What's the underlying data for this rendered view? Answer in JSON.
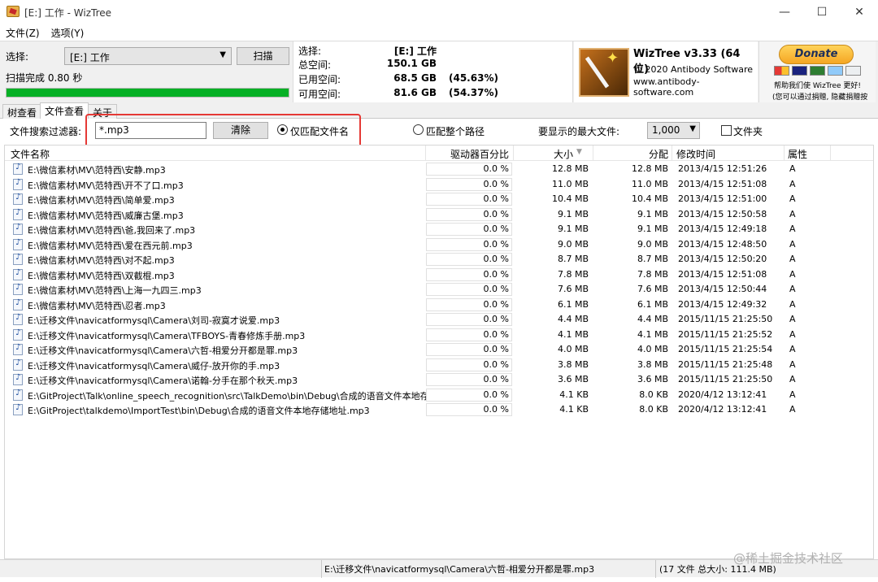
{
  "window": {
    "title": "[E:] 工作 - WizTree"
  },
  "menu": [
    "文件(Z)",
    "选项(Y)"
  ],
  "scan": {
    "select_label": "选择:",
    "drive_value": "[E:] 工作",
    "scan_button": "扫描",
    "status": "扫描完成 0.80 秒",
    "progress": 1.0
  },
  "stats": {
    "select_label": "选择:",
    "select_value": "[E:]  工作",
    "total_label": "总空间:",
    "total_value": "150.1 GB",
    "used_label": "已用空间:",
    "used_value": "68.5 GB",
    "used_pct": "(45.63%)",
    "free_label": "可用空间:",
    "free_value": "81.6 GB",
    "free_pct": "(54.37%)"
  },
  "brand": {
    "name": "WizTree v3.33 (64 位)",
    "copyright": "© 2020 Antibody Software",
    "url": "www.antibody-software.com"
  },
  "donate": {
    "button": "Donate",
    "note1": "帮助我们使 WizTree 更好!",
    "note2": "(您可以通过捐赠, 隐藏捐赠按钮)"
  },
  "tabs": [
    "树查看",
    "文件查看",
    "关于"
  ],
  "filter": {
    "label": "文件搜索过滤器:",
    "value": "*.mp3",
    "clear_button": "清除",
    "radio_filename": "仅匹配文件名",
    "radio_fullpath": "匹配整个路径",
    "max_files_label": "要显示的最大文件:",
    "max_files_value": "1,000",
    "folders_label": "文件夹"
  },
  "columns": {
    "name": "文件名称",
    "pct": "驱动器百分比",
    "size": "大小",
    "alloc": "分配",
    "mtime": "修改时间",
    "attr": "属性"
  },
  "files": [
    {
      "name": "E:\\微信素材\\MV\\范特西\\安静.mp3",
      "pct": "0.0 %",
      "size": "12.8 MB",
      "alloc": "12.8 MB",
      "mtime": "2013/4/15 12:51:26",
      "attr": "A"
    },
    {
      "name": "E:\\微信素材\\MV\\范特西\\开不了口.mp3",
      "pct": "0.0 %",
      "size": "11.0 MB",
      "alloc": "11.0 MB",
      "mtime": "2013/4/15 12:51:08",
      "attr": "A"
    },
    {
      "name": "E:\\微信素材\\MV\\范特西\\简单爱.mp3",
      "pct": "0.0 %",
      "size": "10.4 MB",
      "alloc": "10.4 MB",
      "mtime": "2013/4/15 12:51:00",
      "attr": "A"
    },
    {
      "name": "E:\\微信素材\\MV\\范特西\\威廉古堡.mp3",
      "pct": "0.0 %",
      "size": "9.1 MB",
      "alloc": "9.1 MB",
      "mtime": "2013/4/15 12:50:58",
      "attr": "A"
    },
    {
      "name": "E:\\微信素材\\MV\\范特西\\爸,我回来了.mp3",
      "pct": "0.0 %",
      "size": "9.1 MB",
      "alloc": "9.1 MB",
      "mtime": "2013/4/15 12:49:18",
      "attr": "A"
    },
    {
      "name": "E:\\微信素材\\MV\\范特西\\爱在西元前.mp3",
      "pct": "0.0 %",
      "size": "9.0 MB",
      "alloc": "9.0 MB",
      "mtime": "2013/4/15 12:48:50",
      "attr": "A"
    },
    {
      "name": "E:\\微信素材\\MV\\范特西\\对不起.mp3",
      "pct": "0.0 %",
      "size": "8.7 MB",
      "alloc": "8.7 MB",
      "mtime": "2013/4/15 12:50:20",
      "attr": "A"
    },
    {
      "name": "E:\\微信素材\\MV\\范特西\\双截棍.mp3",
      "pct": "0.0 %",
      "size": "7.8 MB",
      "alloc": "7.8 MB",
      "mtime": "2013/4/15 12:51:08",
      "attr": "A"
    },
    {
      "name": "E:\\微信素材\\MV\\范特西\\上海一九四三.mp3",
      "pct": "0.0 %",
      "size": "7.6 MB",
      "alloc": "7.6 MB",
      "mtime": "2013/4/15 12:50:44",
      "attr": "A"
    },
    {
      "name": "E:\\微信素材\\MV\\范特西\\忍者.mp3",
      "pct": "0.0 %",
      "size": "6.1 MB",
      "alloc": "6.1 MB",
      "mtime": "2013/4/15 12:49:32",
      "attr": "A"
    },
    {
      "name": "E:\\迁移文件\\navicatformysql\\Camera\\刘司-寂寞才说爱.mp3",
      "pct": "0.0 %",
      "size": "4.4 MB",
      "alloc": "4.4 MB",
      "mtime": "2015/11/15 21:25:50",
      "attr": "A"
    },
    {
      "name": "E:\\迁移文件\\navicatformysql\\Camera\\TFBOYS-青春修炼手册.mp3",
      "pct": "0.0 %",
      "size": "4.1 MB",
      "alloc": "4.1 MB",
      "mtime": "2015/11/15 21:25:52",
      "attr": "A"
    },
    {
      "name": "E:\\迁移文件\\navicatformysql\\Camera\\六哲-相爱分开都是罪.mp3",
      "pct": "0.0 %",
      "size": "4.0 MB",
      "alloc": "4.0 MB",
      "mtime": "2015/11/15 21:25:54",
      "attr": "A"
    },
    {
      "name": "E:\\迁移文件\\navicatformysql\\Camera\\威仔-放开你的手.mp3",
      "pct": "0.0 %",
      "size": "3.8 MB",
      "alloc": "3.8 MB",
      "mtime": "2015/11/15 21:25:48",
      "attr": "A"
    },
    {
      "name": "E:\\迁移文件\\navicatformysql\\Camera\\诺翰-分手在那个秋天.mp3",
      "pct": "0.0 %",
      "size": "3.6 MB",
      "alloc": "3.6 MB",
      "mtime": "2015/11/15 21:25:50",
      "attr": "A"
    },
    {
      "name": "E:\\GitProject\\Talk\\online_speech_recognition\\src\\TalkDemo\\bin\\Debug\\合成的语音文件本地存储地址",
      "pct": "0.0 %",
      "size": "4.1 KB",
      "alloc": "8.0 KB",
      "mtime": "2020/4/12 13:12:41",
      "attr": "A"
    },
    {
      "name": "E:\\GitProject\\talkdemo\\ImportTest\\bin\\Debug\\合成的语音文件本地存储地址.mp3",
      "pct": "0.0 %",
      "size": "4.1 KB",
      "alloc": "8.0 KB",
      "mtime": "2020/4/12 13:12:41",
      "attr": "A"
    }
  ],
  "statusbar": {
    "path": "E:\\迁移文件\\navicatformysql\\Camera\\六哲-相爱分开都是罪.mp3",
    "summary": "(17 文件  总大小: 111.4 MB)"
  },
  "watermark": "@稀土掘金技术社区",
  "colors": {
    "progress": "#06b025",
    "highlight": "#e53935"
  }
}
